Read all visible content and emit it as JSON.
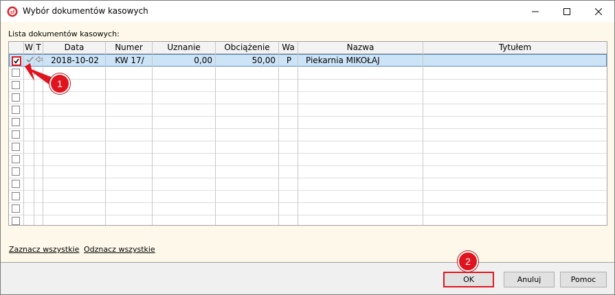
{
  "window": {
    "title": "Wybór dokumentów kasowych"
  },
  "list": {
    "label": "Lista dokumentów kasowych:",
    "columns": [
      "",
      "W",
      "T",
      "Data",
      "Numer",
      "Uznanie",
      "Obciążenie",
      "Wa",
      "Nazwa",
      "Tytułem"
    ],
    "rows": [
      {
        "checked": true,
        "date": "2018-10-02",
        "number": "KW 17/",
        "credit": "0,00",
        "debit": "50,00",
        "wa": "P",
        "name": "Piekarnia MIKOŁAJ",
        "title": ""
      }
    ],
    "empty_rows": 13
  },
  "links": {
    "select_all": "Zaznacz wszystkie",
    "deselect_all": "Odznacz wszystkie"
  },
  "buttons": {
    "ok": "OK",
    "cancel": "Anuluj",
    "help": "Pomoc"
  },
  "annotations": {
    "step1": "1",
    "step2": "2"
  },
  "colors": {
    "highlight": "#e0141f",
    "selection": "#cde4f7",
    "background": "#fdf8e9"
  }
}
